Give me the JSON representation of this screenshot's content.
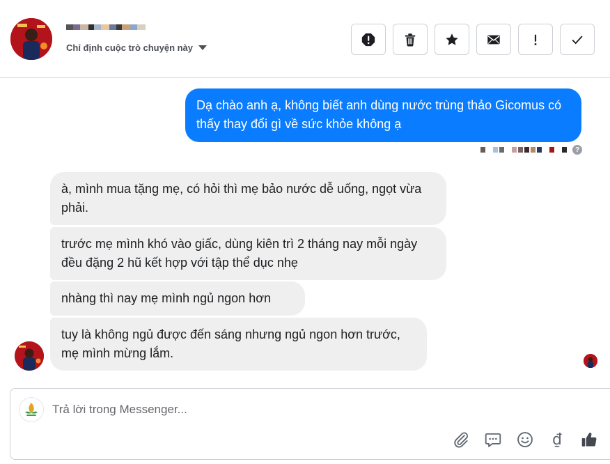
{
  "header": {
    "assign_label": "Chỉ định cuộc trò chuyện này",
    "action_icons": [
      "alert-octagon-icon",
      "trash-icon",
      "star-icon",
      "envelope-icon",
      "exclamation-icon",
      "checkmark-icon"
    ]
  },
  "messages": {
    "outgoing": [
      {
        "text": "Dạ chào anh ạ, không biết anh dùng nước trùng thảo Gicomus có thấy thay đổi gì về sức khỏe không ạ"
      }
    ],
    "incoming": [
      {
        "text": "à, mình mua tặng mẹ, có hỏi thì mẹ bảo nước dễ uống, ngọt vừa phải."
      },
      {
        "text": "trước mẹ mình khó vào giấc, dùng kiên trì 2 tháng nay mỗi ngày đều đặng 2 hũ kết hợp với tập thể dục nhẹ"
      },
      {
        "text": "nhàng thì nay mẹ mình ngủ ngon hơn"
      },
      {
        "text": "tuy là không ngủ được đến sáng nhưng ngủ ngon hơn trước, mẹ mình mừng lắm."
      }
    ]
  },
  "composer": {
    "placeholder": "Trả lời trong Messenger...",
    "tool_icons": [
      "paperclip-icon",
      "chat-bubble-icon",
      "smiley-icon",
      "dong-currency-icon",
      "thumbs-up-icon"
    ],
    "currency_symbol": "₫"
  },
  "colors": {
    "outgoing_bubble": "#0a7cff",
    "incoming_bubble": "#efefef",
    "border": "#ccd0d5",
    "icon": "#606770"
  }
}
